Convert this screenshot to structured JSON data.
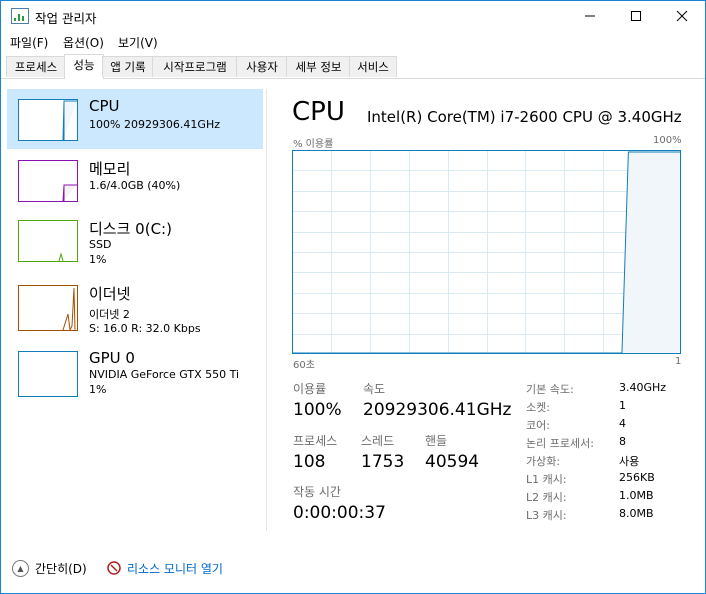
{
  "window": {
    "title": "작업 관리자"
  },
  "menu": [
    "파일(F)",
    "옵션(O)",
    "보기(V)"
  ],
  "tabs": [
    "프로세스",
    "성능",
    "앱 기록",
    "시작프로그램",
    "사용자",
    "세부 정보",
    "서비스"
  ],
  "active_tab": "성능",
  "sidebar": {
    "items": [
      {
        "title": "CPU",
        "sub1": "100%  20929306.41GHz",
        "sub2": "",
        "color": "#117dbb"
      },
      {
        "title": "메모리",
        "sub1": "1.6/4.0GB (40%)",
        "sub2": "",
        "color": "#8b12ae"
      },
      {
        "title": "디스크 0(C:)",
        "sub1": "SSD",
        "sub2": "1%",
        "color": "#4da60c"
      },
      {
        "title": "이더넷",
        "sub1": "이더넷 2",
        "sub2": "S: 16.0  R: 32.0 Kbps",
        "color": "#a74f01"
      },
      {
        "title": "GPU 0",
        "sub1": "NVIDIA GeForce GTX 550 Ti",
        "sub2": "1%",
        "color": "#117dbb"
      }
    ]
  },
  "main": {
    "title": "CPU",
    "model": "Intel(R) Core(TM) i7-2600 CPU @ 3.40GHz",
    "graph": {
      "top_left": "% 이용률",
      "top_right": "100%",
      "bottom_left": "60초",
      "bottom_right": "1",
      "line_color": "#117dbb",
      "fill_color": "#f1f6fa",
      "grid_color": "#d9eaf4",
      "usage_history": [
        0,
        0,
        0,
        0,
        0,
        0,
        0,
        0,
        0,
        0,
        0,
        0,
        0,
        0,
        0,
        0,
        0,
        0,
        0,
        0,
        0,
        0,
        0,
        0,
        0,
        0,
        0,
        0,
        0,
        0,
        0,
        0,
        0,
        0,
        0,
        0,
        0,
        0,
        0,
        0,
        0,
        0,
        0,
        0,
        0,
        0,
        0,
        0,
        0,
        0,
        0,
        0,
        100,
        100,
        100,
        100,
        100,
        100,
        100,
        100,
        100
      ]
    },
    "stats": {
      "usage_label": "이용률",
      "usage_value": "100%",
      "speed_label": "속도",
      "speed_value": "20929306.41GHz",
      "processes_label": "프로세스",
      "processes_value": "108",
      "threads_label": "스레드",
      "threads_value": "1753",
      "handles_label": "핸들",
      "handles_value": "40594",
      "uptime_label": "작동 시간",
      "uptime_value": "0:00:00:37"
    },
    "details": [
      {
        "label": "기본 속도:",
        "value": "3.40GHz"
      },
      {
        "label": "소켓:",
        "value": "1"
      },
      {
        "label": "코어:",
        "value": "4"
      },
      {
        "label": "논리 프로세서:",
        "value": "8"
      },
      {
        "label": "가상화:",
        "value": "사용"
      },
      {
        "label": "L1 캐시:",
        "value": "256KB"
      },
      {
        "label": "L2 캐시:",
        "value": "1.0MB"
      },
      {
        "label": "L3 캐시:",
        "value": "8.0MB"
      }
    ]
  },
  "footer": {
    "collapse_label": "간단히(D)",
    "resource_monitor_label": "리소스 모니터 열기"
  }
}
